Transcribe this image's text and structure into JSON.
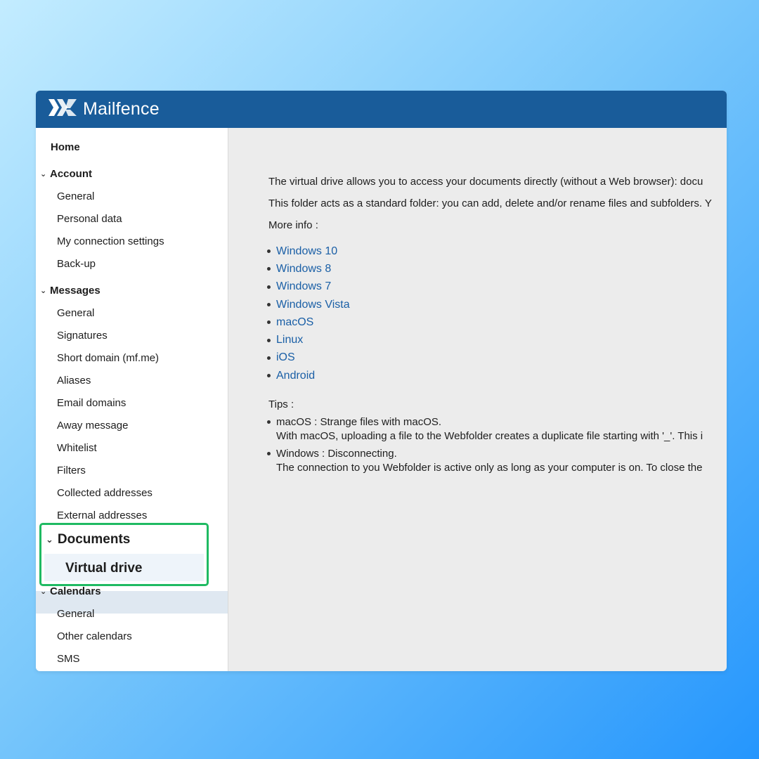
{
  "app": {
    "name": "Mailfence"
  },
  "sidebar": {
    "home": "Home",
    "sections": [
      {
        "label": "Account",
        "items": [
          "General",
          "Personal data",
          "My connection settings",
          "Back-up"
        ]
      },
      {
        "label": "Messages",
        "items": [
          "General",
          "Signatures",
          "Short domain (mf.me)",
          "Aliases",
          "Email domains",
          "Away message",
          "Whitelist",
          "Filters",
          "Collected addresses",
          "External addresses"
        ]
      },
      {
        "label": "Documents",
        "items": [
          "Virtual drive"
        ]
      },
      {
        "label": "Calendars",
        "items": [
          "General",
          "Other calendars"
        ]
      },
      {
        "label": "SMS",
        "items": []
      }
    ],
    "active_item": "Virtual drive"
  },
  "content": {
    "intro": "The virtual drive allows you to access your documents directly (without a Web browser): docu",
    "folder_text": "This folder acts as a standard folder: you can add, delete and/or rename files and subfolders. Y",
    "more_info": "More info :",
    "links": [
      "Windows 10",
      "Windows 8",
      "Windows 7",
      "Windows Vista",
      "macOS",
      "Linux",
      "iOS",
      "Android"
    ],
    "tips_label": "Tips :",
    "tips": [
      {
        "title": "macOS : Strange files with macOS.",
        "body": "With macOS, uploading a file to the Webfolder creates a duplicate file starting with '_'. This i"
      },
      {
        "title": "Windows : Disconnecting.",
        "body": "The connection to you Webfolder is active only as long as your computer is on. To close the"
      }
    ]
  },
  "colors": {
    "header": "#195c9a",
    "link": "#1a5fa6",
    "highlight_border": "#1fba62",
    "active_row": "#dfe8f1"
  }
}
